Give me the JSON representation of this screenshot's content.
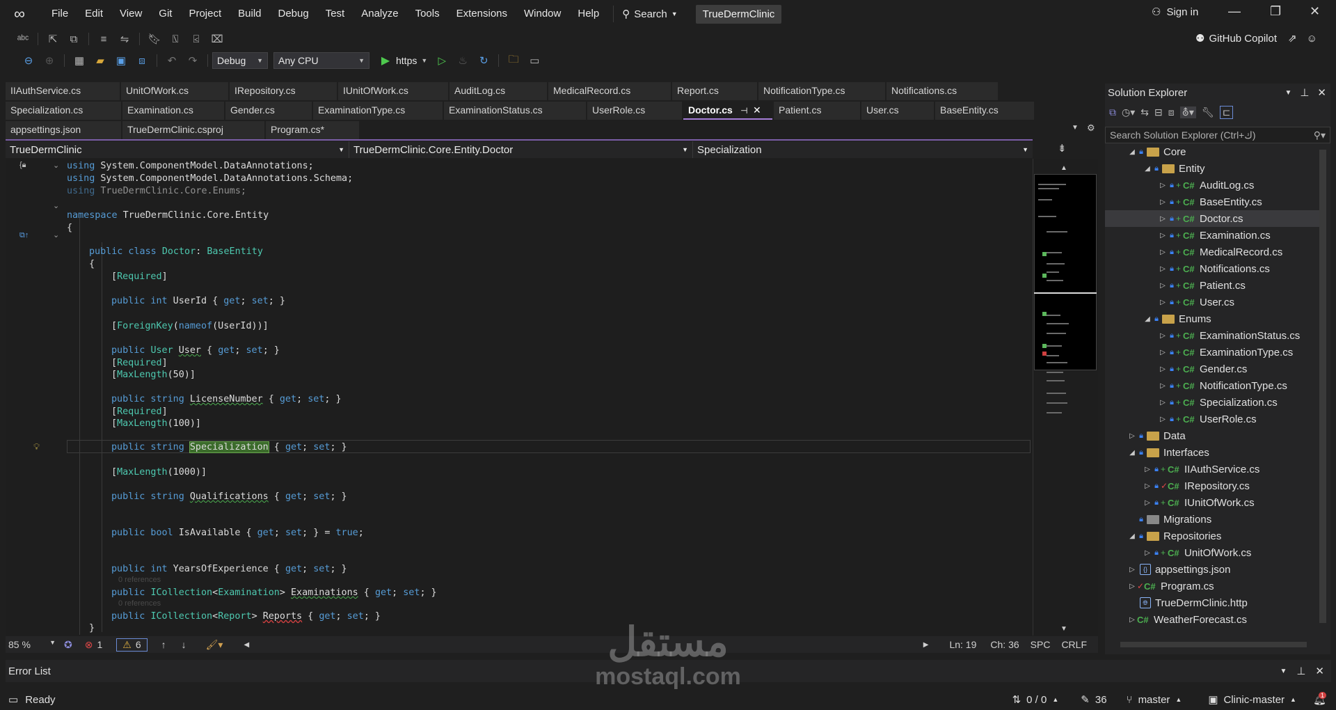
{
  "title_bar": {
    "menu": [
      "File",
      "Edit",
      "View",
      "Git",
      "Project",
      "Build",
      "Debug",
      "Test",
      "Analyze",
      "Tools",
      "Extensions",
      "Window",
      "Help"
    ],
    "search_label": "Search",
    "solution_name": "TrueDermClinic",
    "sign_in": "Sign in"
  },
  "toolbar": {
    "config": "Debug",
    "platform": "Any CPU",
    "run_target": "https",
    "copilot": "GitHub Copilot"
  },
  "tabs": {
    "row1": [
      "IIAuthService.cs",
      "UnitOfWork.cs",
      "IRepository.cs",
      "IUnitOfWork.cs",
      "AuditLog.cs",
      "MedicalRecord.cs",
      "Report.cs",
      "NotificationType.cs",
      "Notifications.cs"
    ],
    "row2": [
      "Specialization.cs",
      "Examination.cs",
      "Gender.cs",
      "ExaminationType.cs",
      "ExaminationStatus.cs",
      "UserRole.cs",
      "Doctor.cs",
      "Patient.cs",
      "User.cs",
      "BaseEntity.cs"
    ],
    "row3": [
      "appsettings.json",
      "TrueDermClinic.csproj",
      "Program.cs*"
    ],
    "active": "Doctor.cs"
  },
  "navbar": {
    "project": "TrueDermClinic",
    "type": "TrueDermClinic.Core.Entity.Doctor",
    "member": "Specialization"
  },
  "code": {
    "usings": [
      "System.ComponentModel.DataAnnotations;",
      "System.ComponentModel.DataAnnotations.Schema;",
      "TrueDermClinic.Core.Enums;"
    ],
    "namespace": "TrueDermClinic.Core.Entity",
    "class_name": "Doctor",
    "base_class": "BaseEntity",
    "references_label": "0 references"
  },
  "editor_status": {
    "zoom": "85 %",
    "errors": "1",
    "warnings": "6",
    "line": "Ln: 19",
    "col": "Ch: 36",
    "spc": "SPC",
    "eol": "CRLF"
  },
  "solution_explorer": {
    "title": "Solution Explorer",
    "search_placeholder": "Search Solution Explorer (Ctrl+ك)",
    "items": [
      {
        "label": "Core",
        "kind": "folder",
        "level": 1,
        "expanded": true
      },
      {
        "label": "Entity",
        "kind": "folder",
        "level": 2,
        "expanded": true
      },
      {
        "label": "AuditLog.cs",
        "kind": "cs",
        "level": 3
      },
      {
        "label": "BaseEntity.cs",
        "kind": "cs",
        "level": 3
      },
      {
        "label": "Doctor.cs",
        "kind": "cs",
        "level": 3,
        "selected": true
      },
      {
        "label": "Examination.cs",
        "kind": "cs",
        "level": 3
      },
      {
        "label": "MedicalRecord.cs",
        "kind": "cs",
        "level": 3
      },
      {
        "label": "Notifications.cs",
        "kind": "cs",
        "level": 3
      },
      {
        "label": "Patient.cs",
        "kind": "cs",
        "level": 3
      },
      {
        "label": "User.cs",
        "kind": "cs",
        "level": 3
      },
      {
        "label": "Enums",
        "kind": "folder",
        "level": 2,
        "expanded": true
      },
      {
        "label": "ExaminationStatus.cs",
        "kind": "cs",
        "level": 3
      },
      {
        "label": "ExaminationType.cs",
        "kind": "cs",
        "level": 3
      },
      {
        "label": "Gender.cs",
        "kind": "cs",
        "level": 3
      },
      {
        "label": "NotificationType.cs",
        "kind": "cs",
        "level": 3
      },
      {
        "label": "Specialization.cs",
        "kind": "cs",
        "level": 3
      },
      {
        "label": "UserRole.cs",
        "kind": "cs",
        "level": 3
      },
      {
        "label": "Data",
        "kind": "folder",
        "level": 1
      },
      {
        "label": "Interfaces",
        "kind": "folder",
        "level": 1,
        "expanded": true
      },
      {
        "label": "IIAuthService.cs",
        "kind": "cs",
        "level": 2
      },
      {
        "label": "IRepository.cs",
        "kind": "cs-mod",
        "level": 2
      },
      {
        "label": "IUnitOfWork.cs",
        "kind": "cs",
        "level": 2
      },
      {
        "label": "Migrations",
        "kind": "folder-x",
        "level": 1
      },
      {
        "label": "Repositories",
        "kind": "folder",
        "level": 1,
        "expanded": true
      },
      {
        "label": "UnitOfWork.cs",
        "kind": "cs",
        "level": 2
      },
      {
        "label": "appsettings.json",
        "kind": "json",
        "level": 1
      },
      {
        "label": "Program.cs",
        "kind": "cs-mod",
        "level": 1
      },
      {
        "label": "TrueDermClinic.http",
        "kind": "http",
        "level": 1
      },
      {
        "label": "WeatherForecast.cs",
        "kind": "cs",
        "level": 1
      }
    ]
  },
  "error_list": {
    "title": "Error List"
  },
  "status_bar": {
    "ready": "Ready",
    "sync": "0 / 0",
    "edits": "36",
    "branch": "master",
    "repo": "Clinic-master",
    "notifications": "1"
  },
  "watermark": {
    "arabic": "مستقل",
    "latin": "mostaql.com"
  }
}
